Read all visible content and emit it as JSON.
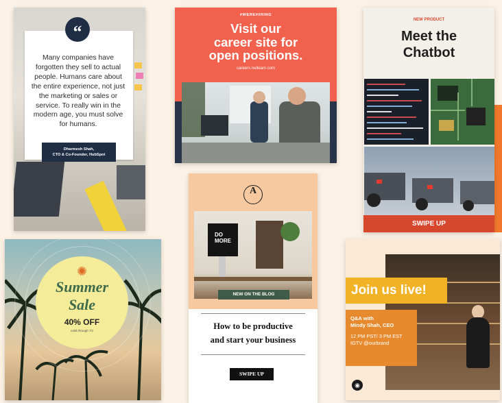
{
  "quote_card": {
    "icon": "quote-icon",
    "text": "Many companies have forgotten they sell to actual people. Humans care about the entire experience, not just the marketing or sales or service. To really win in the modern age, you must solve for humans.",
    "author_line1": "Dharmesh Shah,",
    "author_line2": "CTO & Co-Founder, HubSpot"
  },
  "career_card": {
    "tag": "#WEREHIRING",
    "title_line1": "Visit our",
    "title_line2": "career site for",
    "title_line3": "open positions.",
    "url": "careers.nuiteam.com",
    "bg_color": "#f2614d"
  },
  "chatbot_card": {
    "tag": "NEW PRODUCT",
    "title_line1": "Meet the",
    "title_line2": "Chatbot",
    "cta": "SWIPE UP",
    "accent": "#d7472d"
  },
  "blog_card": {
    "logo_letter": "A",
    "monitor_text1": "DO",
    "monitor_text2": "MORE",
    "tag": "NEW ON THE BLOG",
    "title_line1": "How to be productive",
    "title_line2": "and start your business",
    "cta": "SWIPE UP"
  },
  "summer_card": {
    "icon": "sun-icon",
    "title_line1": "Summer",
    "title_line2": "Sale",
    "discount": "40% OFF",
    "fine_print": "valid through 7/1"
  },
  "live_card": {
    "title": "Join us live!",
    "line1": "Q&A with",
    "line2": "Mindy Shah, CEO",
    "time": "12 PM PST/ 3 PM EST",
    "channel": "IGTV @ourbrand",
    "icon": "igtv-icon"
  }
}
